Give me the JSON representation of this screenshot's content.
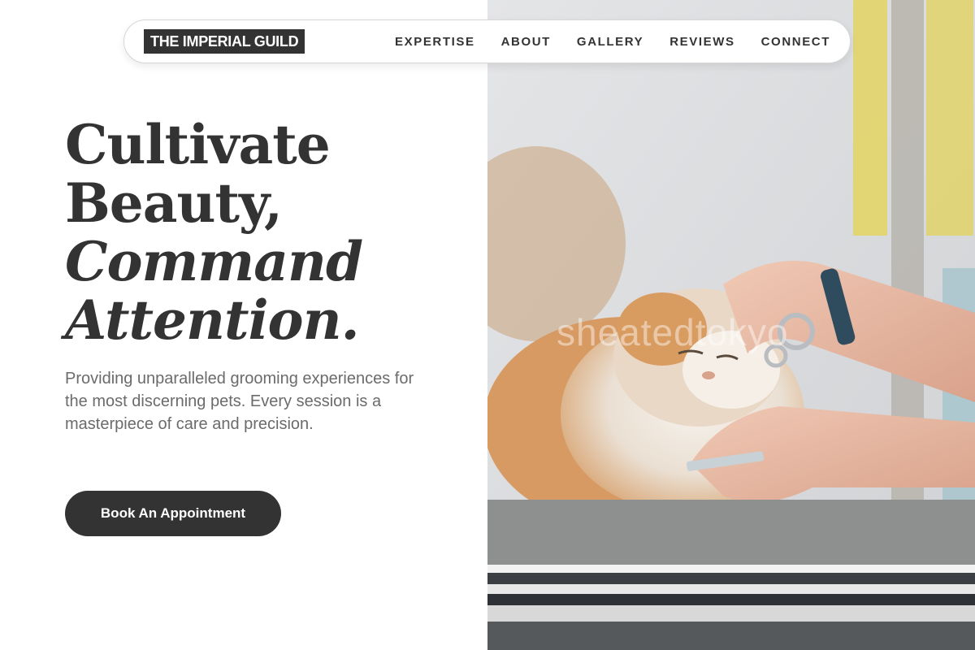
{
  "brand": {
    "logo_text": "THE IMPERIAL GUILD"
  },
  "nav": {
    "links": [
      {
        "label": "EXPERTISE"
      },
      {
        "label": "ABOUT"
      },
      {
        "label": "GALLERY"
      },
      {
        "label": "REVIEWS"
      },
      {
        "label": "CONNECT"
      }
    ]
  },
  "hero": {
    "heading_line1": "Cultivate",
    "heading_line2": "Beauty,",
    "heading_line3": "Command",
    "heading_line4": "Attention.",
    "subtext": "Providing unparalleled grooming experiences for the most discerning pets. Every session is a masterpiece of care and precision.",
    "cta_label": "Book An Appointment",
    "image_watermark": "sheatedtokyo"
  },
  "colors": {
    "primary_dark": "#333333",
    "text_muted": "#6b6b6b",
    "background": "#ffffff"
  },
  "icons": {
    "hero_image": "cat-grooming-photo"
  }
}
